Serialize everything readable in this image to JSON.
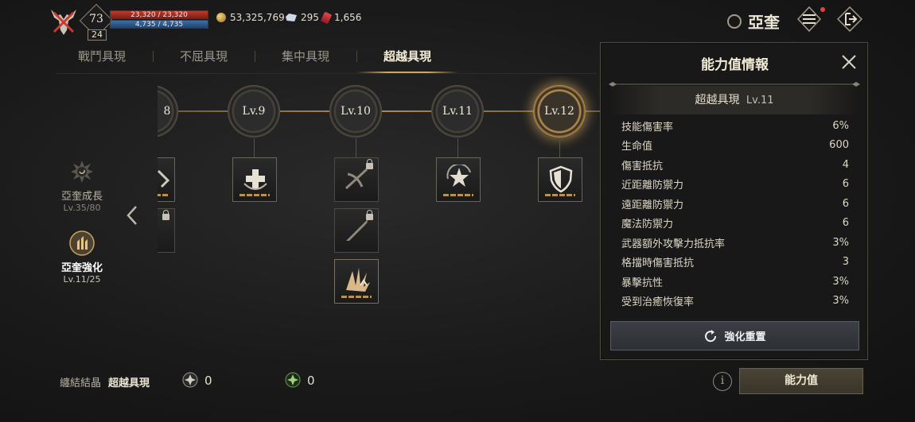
{
  "player": {
    "level": "73",
    "sub_level": "24",
    "hp": "23,320 / 23,320",
    "mp": "4,735 / 4,735",
    "gold": "53,325,769",
    "gem": "295",
    "ruby": "1,656",
    "name": "亞奎"
  },
  "tabs": [
    {
      "label": "戰鬥具現"
    },
    {
      "label": "不屈具現"
    },
    {
      "label": "集中具現"
    },
    {
      "label": "超越具現"
    }
  ],
  "side": {
    "growth": {
      "label": "亞奎成長",
      "sub": "Lv.35/80"
    },
    "enhance": {
      "label": "亞奎強化",
      "sub": "Lv.11/25"
    }
  },
  "tree": {
    "nodes": [
      {
        "label": "8"
      },
      {
        "label": "Lv.9"
      },
      {
        "label": "Lv.10"
      },
      {
        "label": "Lv.11"
      },
      {
        "label": "Lv.12"
      }
    ]
  },
  "panel": {
    "title": "能力值情報",
    "subtitle": "超越具現",
    "subtitle_level": "Lv.11",
    "stats": [
      {
        "name": "技能傷害率",
        "value": "6%"
      },
      {
        "name": "生命值",
        "value": "600"
      },
      {
        "name": "傷害抵抗",
        "value": "4"
      },
      {
        "name": "近距離防禦力",
        "value": "6"
      },
      {
        "name": "遠距離防禦力",
        "value": "6"
      },
      {
        "name": "魔法防禦力",
        "value": "6"
      },
      {
        "name": "武器額外攻擊力抵抗率",
        "value": "3%"
      },
      {
        "name": "格擋時傷害抵抗",
        "value": "3"
      },
      {
        "name": "暴擊抗性",
        "value": "3%"
      },
      {
        "name": "受到治癒恢復率",
        "value": "3%"
      }
    ],
    "reset_label": "強化重置"
  },
  "bottom": {
    "label1": "纏結結晶",
    "label2": "超越具現",
    "count1": "0",
    "count2": "0",
    "info_symbol": "i",
    "stat_button": "能力值"
  },
  "colors": {
    "accent_gold": "#d0a862",
    "hp_red": "#c0392b",
    "mp_blue": "#3e6fa8"
  }
}
